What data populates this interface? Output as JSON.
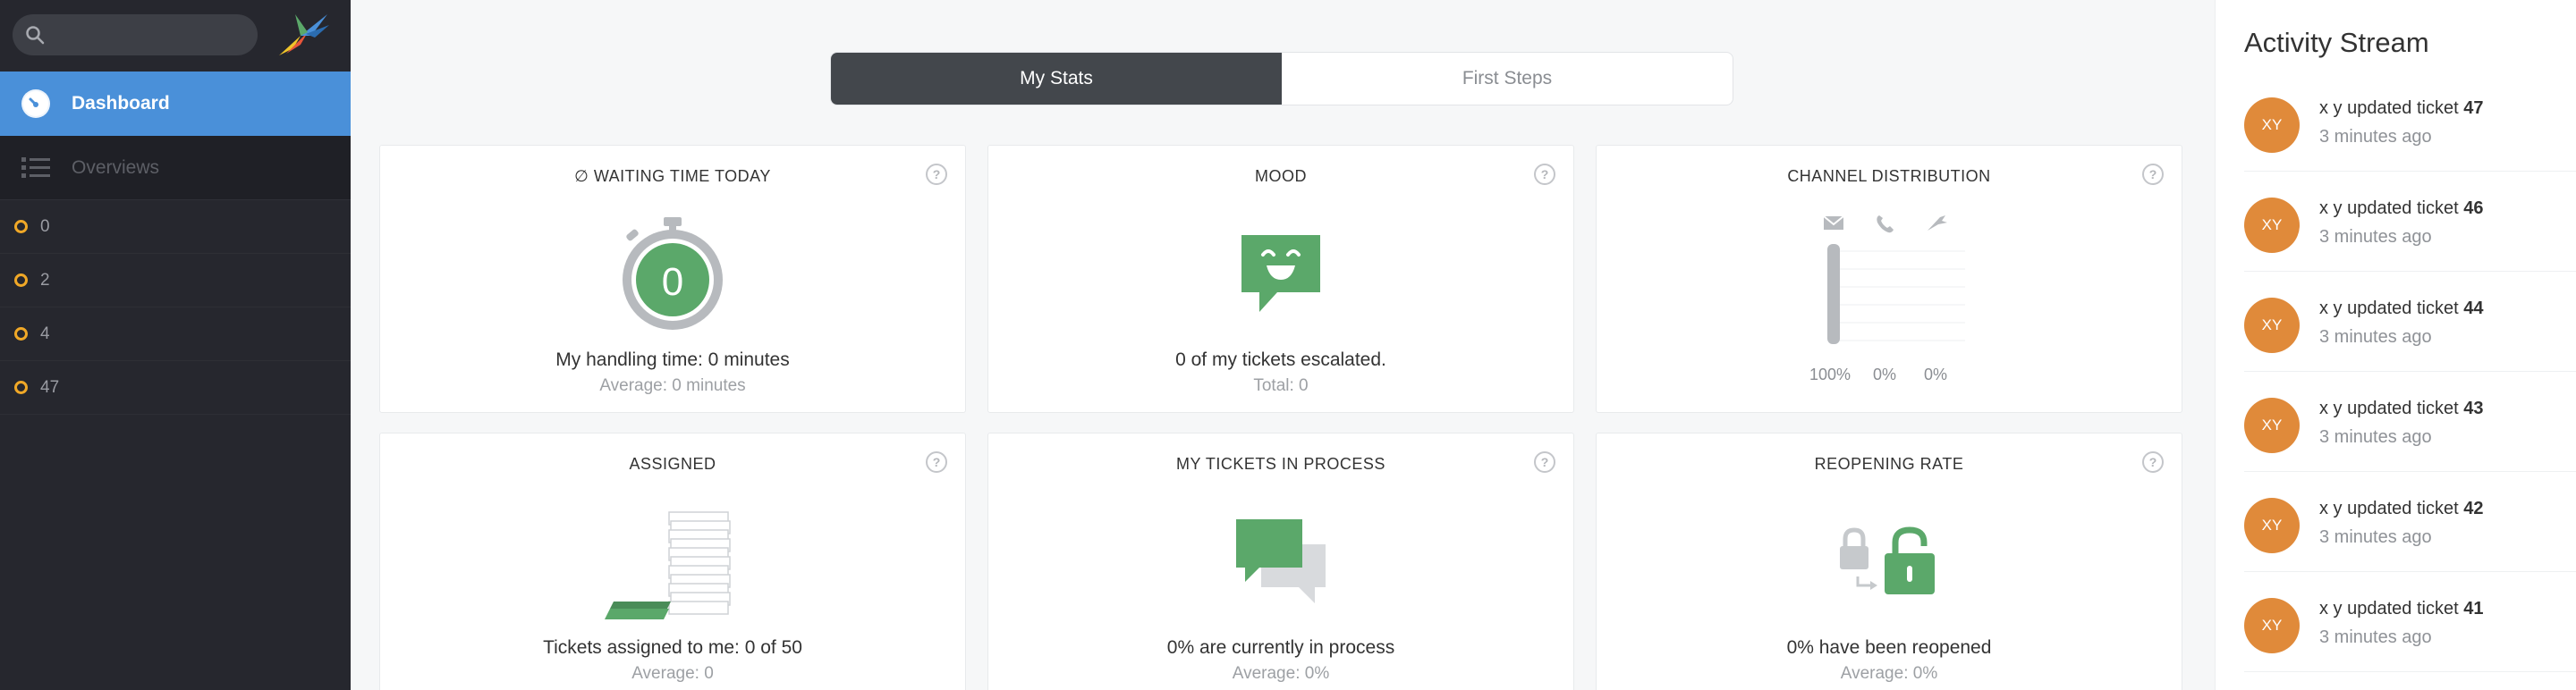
{
  "sidebar": {
    "search": {
      "placeholder": ""
    },
    "nav": [
      {
        "label": "Dashboard",
        "icon": "dashboard-icon",
        "active": true
      },
      {
        "label": "Overviews",
        "icon": "list-icon",
        "active": false
      }
    ],
    "tickets": [
      "0",
      "2",
      "4",
      "47"
    ]
  },
  "tabs": [
    {
      "label": "My Stats",
      "active": true
    },
    {
      "label": "First Steps",
      "active": false
    }
  ],
  "cards": {
    "waiting": {
      "title": "∅ WAITING TIME TODAY",
      "value": "0",
      "line1": "My handling time: 0 minutes",
      "line2": "Average: 0 minutes"
    },
    "mood": {
      "title": "MOOD",
      "line1": "0 of my tickets escalated.",
      "line2": "Total: 0"
    },
    "channel": {
      "title": "CHANNEL DISTRIBUTION",
      "icons": [
        "mail-icon",
        "phone-icon",
        "twitter-icon"
      ],
      "labels": [
        "100%",
        "0%",
        "0%"
      ]
    },
    "assigned": {
      "title": "ASSIGNED",
      "line1": "Tickets assigned to me: 0 of 50",
      "line2": "Average: 0"
    },
    "inprocess": {
      "title": "MY TICKETS IN PROCESS",
      "line1": "0% are currently in process",
      "line2": "Average: 0%"
    },
    "reopening": {
      "title": "REOPENING RATE",
      "line1": "0% have been reopened",
      "line2": "Average: 0%"
    }
  },
  "activity": {
    "title": "Activity Stream",
    "items": [
      {
        "initials": "XY",
        "text": "x y updated ticket",
        "ticket": "47",
        "time": "3 minutes ago"
      },
      {
        "initials": "XY",
        "text": "x y updated ticket",
        "ticket": "46",
        "time": "3 minutes ago"
      },
      {
        "initials": "XY",
        "text": "x y updated ticket",
        "ticket": "44",
        "time": "3 minutes ago"
      },
      {
        "initials": "XY",
        "text": "x y updated ticket",
        "ticket": "43",
        "time": "3 minutes ago"
      },
      {
        "initials": "XY",
        "text": "x y updated ticket",
        "ticket": "42",
        "time": "3 minutes ago"
      },
      {
        "initials": "XY",
        "text": "x y updated ticket",
        "ticket": "41",
        "time": "3 minutes ago"
      }
    ]
  },
  "colors": {
    "accent": "#4a90d9",
    "green": "#5ba86a",
    "avatar": "#e08a3a",
    "ticket_dot": "#f0a827"
  }
}
